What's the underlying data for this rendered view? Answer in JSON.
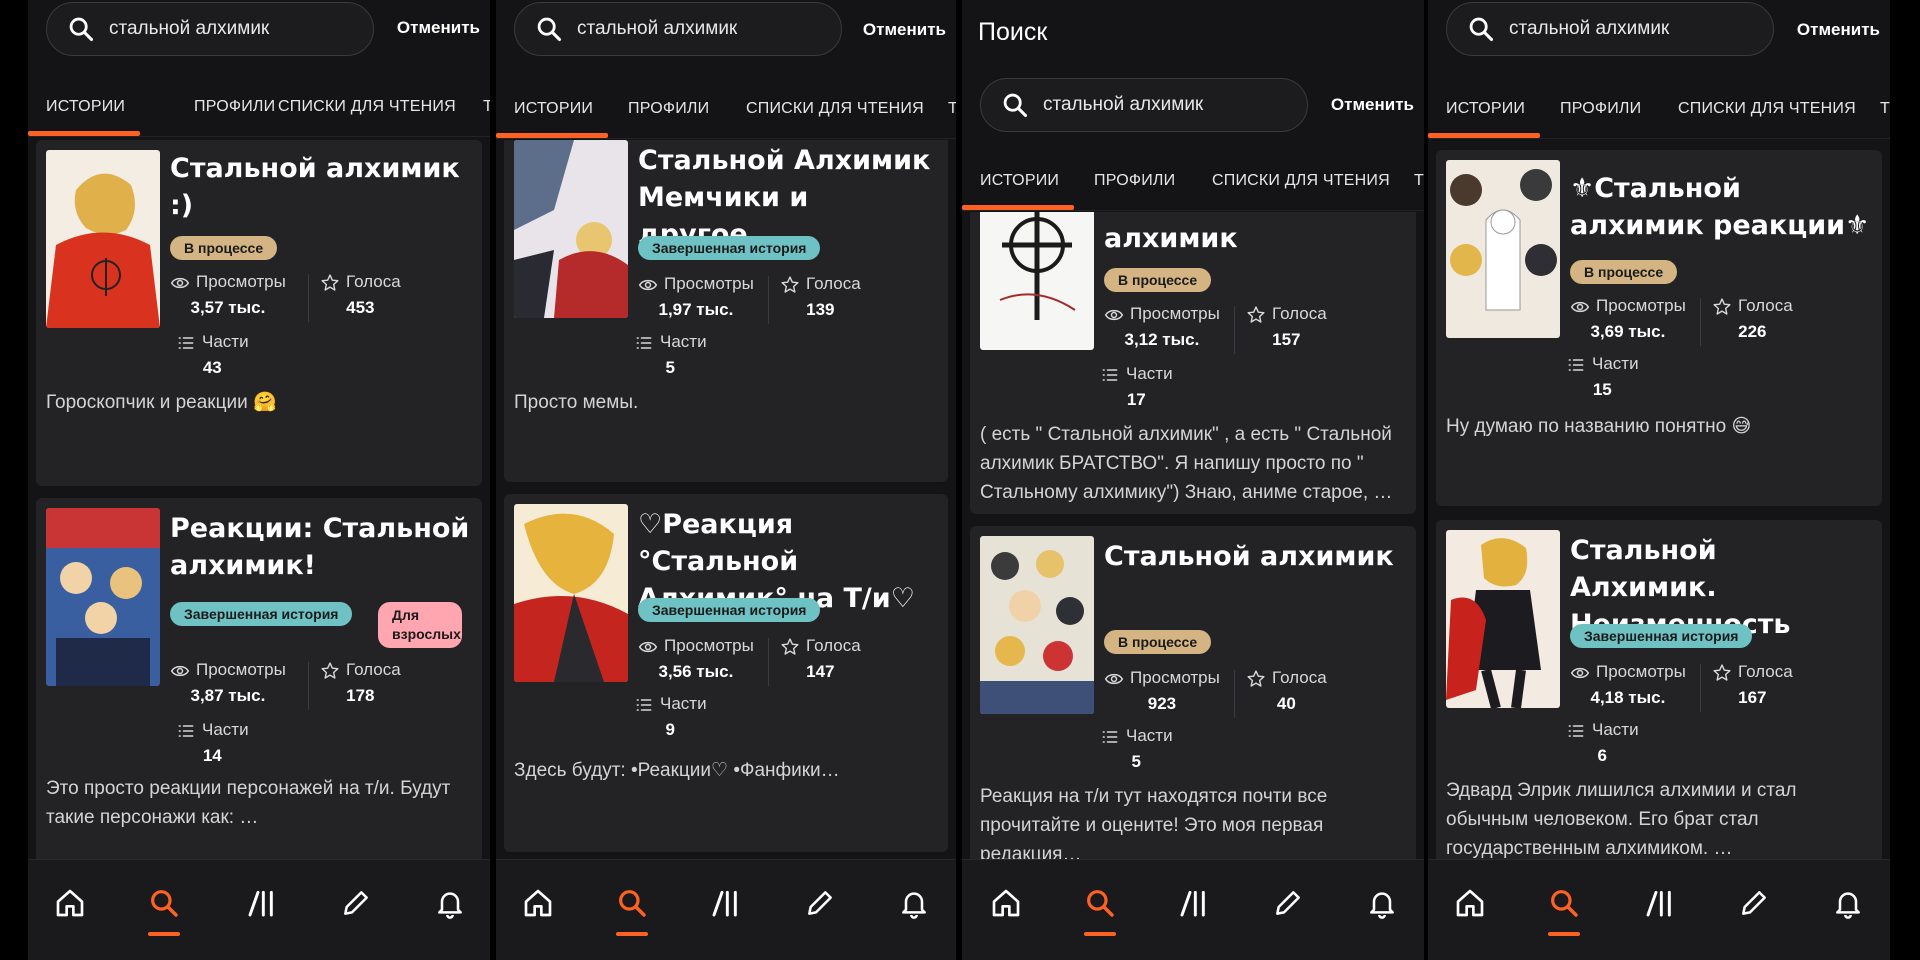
{
  "search": {
    "query": "стальной алхимик",
    "cancel_label": "Отменить"
  },
  "screen_title": "Поиск",
  "tabs": [
    "ИСТОРИИ",
    "ПРОФИЛИ",
    "СПИСКИ ДЛЯ ЧТЕНИЯ",
    "Т"
  ],
  "stat_labels": {
    "views": "Просмотры",
    "votes": "Голоса",
    "parts": "Части"
  },
  "badges": {
    "in_progress": "В процессе",
    "completed": "Завершенная история",
    "adult": "Для взрослых"
  },
  "colors": {
    "accent": "#ff6122",
    "in_progress": "#d4b483",
    "completed": "#6fc2c4",
    "adult": "#ffa6b0",
    "card_bg": "#232326"
  },
  "nav_icons": [
    "home-icon",
    "search-icon",
    "library-icon",
    "write-icon",
    "notifications-icon"
  ],
  "panels": [
    {
      "stories": [
        {
          "title": "Стальной алхимик :)",
          "badge": "В процессе",
          "views": "3,57 тыс.",
          "votes": "453",
          "parts": "43",
          "description": "Гороскопчик и реакции 🤗"
        },
        {
          "title": "Реакции: Стальной алхимик!",
          "badge": "Завершенная история",
          "extra_badge": "Для взрослых",
          "views": "3,87 тыс.",
          "votes": "178",
          "parts": "14",
          "description": "Это просто реакции персонажей на т/и. Будут такие персонажи как: …"
        }
      ]
    },
    {
      "stories": [
        {
          "title": "Стальной Алхимик Мемчики и другое.",
          "badge": "Завершенная история",
          "views": "1,97 тыс.",
          "votes": "139",
          "parts": "5",
          "description": "Просто мемы."
        },
        {
          "title": "♡Реакция °Стальной Алхимик° на Т/и♡",
          "badge": "Завершенная история",
          "views": "3,56 тыс.",
          "votes": "147",
          "parts": "9",
          "description": "Здесь будут: •Реакции♡ •Фанфики…"
        }
      ]
    },
    {
      "stories": [
        {
          "title": "алхимик",
          "badge": "В процессе",
          "views": "3,12 тыс.",
          "votes": "157",
          "parts": "17",
          "description": "( есть \" Стальной алхимик\" , а есть \" Стальной алхимик БРАТСТВО\". Я напишу просто по \" Стальному алхимику\") Знаю, аниме старое, …"
        },
        {
          "title": "Стальной алхимик",
          "badge": "В процессе",
          "views": "923",
          "votes": "40",
          "parts": "5",
          "description": "Реакция на т/и тут находятся почти все прочитайте и оцените! Это моя первая редакция…"
        }
      ]
    },
    {
      "stories": [
        {
          "title": "⚜Стальной алхимик реакции⚜",
          "badge": "В процессе",
          "views": "3,69 тыс.",
          "votes": "226",
          "parts": "15",
          "description": "Ну думаю по названию понятно 😅"
        },
        {
          "title": "Стальной Алхимик. Неизменность",
          "badge": "Завершенная история",
          "views": "4,18 тыс.",
          "votes": "167",
          "parts": "6",
          "description": "Эдвард Элрик лишился алхимии и стал обычным человеком. Его брат стал государственным алхимиком. …"
        }
      ]
    }
  ]
}
